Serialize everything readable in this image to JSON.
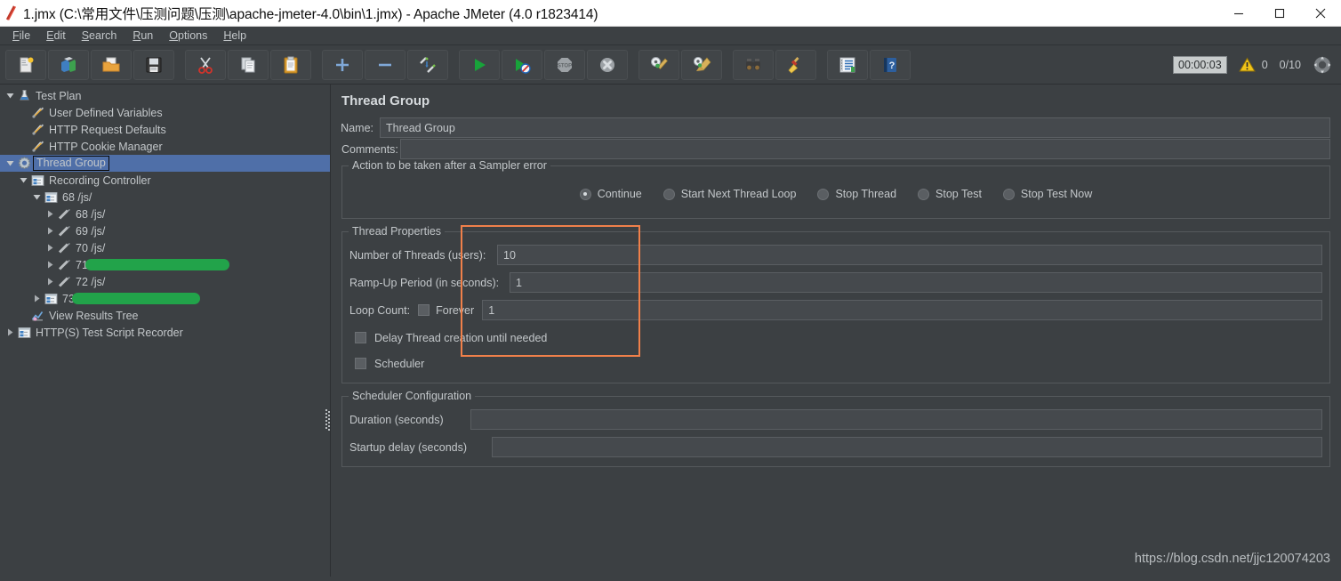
{
  "window": {
    "title": "1.jmx (C:\\常用文件\\压测问题\\压测\\apache-jmeter-4.0\\bin\\1.jmx) - Apache JMeter (4.0 r1823414)",
    "controls": {
      "minimize": "minimize-icon",
      "maximize": "maximize-icon",
      "close": "close-icon"
    }
  },
  "menubar": {
    "items": [
      {
        "mnemonic": "F",
        "rest": "ile"
      },
      {
        "mnemonic": "E",
        "rest": "dit"
      },
      {
        "mnemonic": "S",
        "rest": "earch"
      },
      {
        "mnemonic": "R",
        "rest": "un"
      },
      {
        "mnemonic": "O",
        "rest": "ptions"
      },
      {
        "mnemonic": "H",
        "rest": "elp"
      }
    ]
  },
  "toolbar": {
    "buttons": [
      {
        "name": "new-button",
        "icon": "new-document-icon"
      },
      {
        "name": "templates-button",
        "icon": "templates-icon"
      },
      {
        "name": "open-button",
        "icon": "open-folder-icon"
      },
      {
        "name": "save-button",
        "icon": "save-disk-icon"
      },
      {
        "name": "cut-button",
        "icon": "scissors-icon"
      },
      {
        "name": "copy-button",
        "icon": "copy-icon"
      },
      {
        "name": "paste-button",
        "icon": "clipboard-icon"
      },
      {
        "name": "expand-all-button",
        "icon": "plus-icon"
      },
      {
        "name": "collapse-all-button",
        "icon": "minus-icon"
      },
      {
        "name": "toggle-button",
        "icon": "toggle-pencil-icon"
      },
      {
        "name": "start-button",
        "icon": "green-play-icon"
      },
      {
        "name": "start-no-pauses-button",
        "icon": "green-play-nopause-icon"
      },
      {
        "name": "stop-button",
        "icon": "stop-sign-icon"
      },
      {
        "name": "shutdown-button",
        "icon": "shutdown-x-icon"
      },
      {
        "name": "clear-button",
        "icon": "clear-broom-icon"
      },
      {
        "name": "clear-all-button",
        "icon": "clear-all-broom-icon"
      },
      {
        "name": "search-button",
        "icon": "binoculars-icon"
      },
      {
        "name": "reset-search-button",
        "icon": "broom-icon"
      },
      {
        "name": "function-helper-button",
        "icon": "function-helper-icon"
      },
      {
        "name": "help-button",
        "icon": "help-book-icon"
      }
    ],
    "status": {
      "elapsed": "00:00:03",
      "warning_count": "0",
      "thread_count": "0/10",
      "warning_icon": "warning-triangle-icon",
      "remote_icon": "connection-icon"
    }
  },
  "tree": {
    "items": [
      {
        "label": "Test Plan",
        "icon": "test-plan-icon",
        "indent": 0,
        "twisty": "down",
        "selected": false,
        "redacted": false
      },
      {
        "label": "User Defined Variables",
        "icon": "config-wrench-icon",
        "indent": 1,
        "twisty": "none",
        "selected": false,
        "redacted": false
      },
      {
        "label": "HTTP Request Defaults",
        "icon": "config-wrench-icon",
        "indent": 1,
        "twisty": "none",
        "selected": false,
        "redacted": false
      },
      {
        "label": "HTTP Cookie Manager",
        "icon": "config-wrench-icon",
        "indent": 1,
        "twisty": "none",
        "selected": false,
        "redacted": false
      },
      {
        "label": "Thread Group",
        "icon": "thread-group-gear-icon",
        "indent": 0,
        "twisty": "down",
        "selected": true,
        "redacted": false
      },
      {
        "label": "Recording Controller",
        "icon": "controller-icon",
        "indent": 1,
        "twisty": "down",
        "selected": false,
        "redacted": false
      },
      {
        "label": "68 /js/",
        "icon": "controller-icon",
        "indent": 2,
        "twisty": "down",
        "selected": false,
        "redacted": false
      },
      {
        "label": "68 /js/",
        "icon": "sampler-icon",
        "indent": 3,
        "twisty": "right",
        "selected": false,
        "redacted": false
      },
      {
        "label": "69 /js/",
        "icon": "sampler-icon",
        "indent": 3,
        "twisty": "right",
        "selected": false,
        "redacted": false
      },
      {
        "label": "70 /js/",
        "icon": "sampler-icon",
        "indent": 3,
        "twisty": "right",
        "selected": false,
        "redacted": false
      },
      {
        "label": "71",
        "icon": "sampler-icon",
        "indent": 3,
        "twisty": "right",
        "selected": false,
        "redacted": true,
        "redact_width": 162
      },
      {
        "label": "72 /js/",
        "icon": "sampler-icon",
        "indent": 3,
        "twisty": "right",
        "selected": false,
        "redacted": false
      },
      {
        "label": "73",
        "icon": "controller-icon",
        "indent": 2,
        "twisty": "right",
        "selected": false,
        "redacted": true,
        "redact_width": 144
      },
      {
        "label": "View Results Tree",
        "icon": "listener-icon",
        "indent": 1,
        "twisty": "none",
        "selected": false,
        "redacted": false
      },
      {
        "label": "HTTP(S) Test Script Recorder",
        "icon": "controller-icon",
        "indent": 0,
        "twisty": "right",
        "selected": false,
        "redacted": false
      }
    ]
  },
  "main": {
    "panel_title": "Thread Group",
    "name_label": "Name:",
    "name_value": "Thread Group",
    "comments_label": "Comments:",
    "comments_value": "",
    "sampler_error": {
      "group_label": "Action to be taken after a Sampler error",
      "options": [
        {
          "label": "Continue",
          "selected": true
        },
        {
          "label": "Start Next Thread Loop",
          "selected": false
        },
        {
          "label": "Stop Thread",
          "selected": false
        },
        {
          "label": "Stop Test",
          "selected": false
        },
        {
          "label": "Stop Test Now",
          "selected": false
        }
      ]
    },
    "thread_properties": {
      "group_label": "Thread Properties",
      "num_threads_label": "Number of Threads (users):",
      "num_threads_value": "10",
      "rampup_label": "Ramp-Up Period (in seconds):",
      "rampup_value": "1",
      "loop_count_label": "Loop Count:",
      "forever_label": "Forever",
      "forever_checked": false,
      "loop_count_value": "1",
      "delay_label": "Delay Thread creation until needed",
      "delay_checked": false,
      "scheduler_label": "Scheduler",
      "scheduler_checked": false
    },
    "scheduler_config": {
      "group_label": "Scheduler Configuration",
      "duration_label": "Duration (seconds)",
      "duration_value": "",
      "startup_delay_label": "Startup delay (seconds)",
      "startup_delay_value": ""
    },
    "watermark": "https://blog.csdn.net/jjc120074203"
  },
  "colors": {
    "background": "#3c4043",
    "field": "#45494d",
    "text": "#c3c7ca",
    "selection": "#4f6fa8",
    "annotation": "#f0804a",
    "redaction": "#22a34a"
  }
}
